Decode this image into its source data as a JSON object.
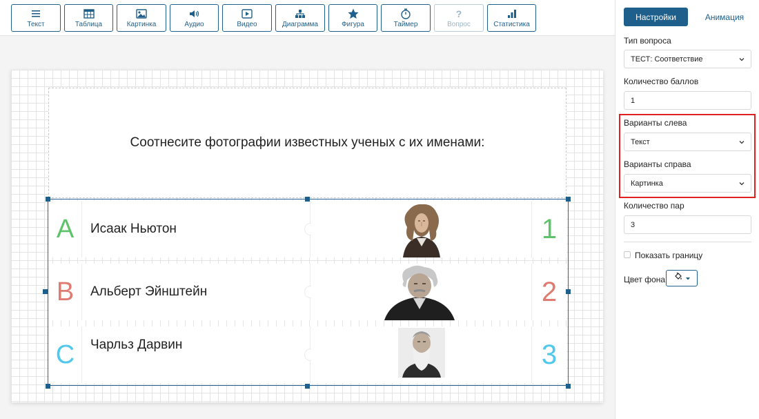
{
  "toolbar": {
    "buttons": [
      {
        "label": "Текст",
        "icon": "text-lines-icon"
      },
      {
        "label": "Таблица",
        "icon": "table-icon"
      },
      {
        "label": "Картинка",
        "icon": "image-icon"
      },
      {
        "label": "Аудио",
        "icon": "audio-icon"
      },
      {
        "label": "Видео",
        "icon": "video-icon"
      },
      {
        "label": "Диаграмма",
        "icon": "diagram-icon"
      },
      {
        "label": "Фигура",
        "icon": "star-icon"
      },
      {
        "label": "Таймер",
        "icon": "timer-icon"
      },
      {
        "label": "Вопрос",
        "icon": "question-icon",
        "disabled": true
      },
      {
        "label": "Статистика",
        "icon": "stats-icon"
      }
    ]
  },
  "slide": {
    "title": "Соотнесите фотографии известных ученых с их именами:",
    "rows": [
      {
        "letter": "A",
        "name": "Исаак Ньютон",
        "number": "1",
        "color": "#5ec36a"
      },
      {
        "letter": "B",
        "name": "Альберт Эйнштейн",
        "number": "2",
        "color": "#e07b72"
      },
      {
        "letter": "C",
        "name": "Чарльз Дарвин",
        "number": "3",
        "color": "#4fc8ec"
      }
    ]
  },
  "panel": {
    "tab_settings": "Настройки",
    "tab_animation": "Анимация",
    "question_type_label": "Тип вопроса",
    "question_type_value": "ТЕСТ: Соответствие",
    "points_label": "Количество баллов",
    "points_value": "1",
    "left_options_label": "Варианты слева",
    "left_options_value": "Текст",
    "right_options_label": "Варианты справа",
    "right_options_value": "Картинка",
    "pairs_label": "Количество пар",
    "pairs_value": "3",
    "show_border_label": "Показать границу",
    "bg_color_label": "Цвет фона"
  },
  "colors": {
    "accent": "#1f5f8b",
    "highlight": "#e02020"
  }
}
